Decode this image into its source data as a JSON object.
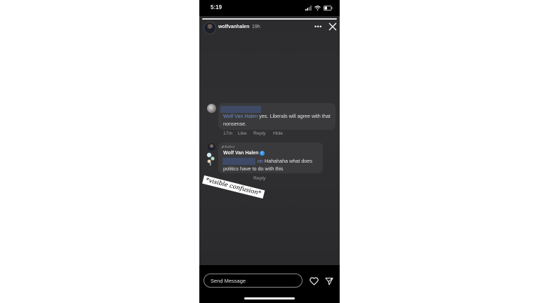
{
  "status_bar": {
    "time": "5:19"
  },
  "story": {
    "username": "wolfvanhalen",
    "posted_ago": "19h",
    "more_icon": "more-dots-icon",
    "close_icon": "close-icon"
  },
  "comment": {
    "mention": "Wolf Van Halen",
    "text": "yes. Liberals will agree with that nonsense.",
    "age": "17m",
    "like_label": "Like",
    "reply_label": "Reply",
    "hide_label": "Hide"
  },
  "reply": {
    "badge": "Author",
    "author": "Wolf Van Halen",
    "mention_suffix": "on",
    "text": "Hahahaha what does politics have to do with this",
    "reply_label": "Reply"
  },
  "caption": "*visible confusion*",
  "footer": {
    "send_placeholder": "Send Message",
    "heart_icon": "heart-icon",
    "send_icon": "paper-plane-icon"
  }
}
